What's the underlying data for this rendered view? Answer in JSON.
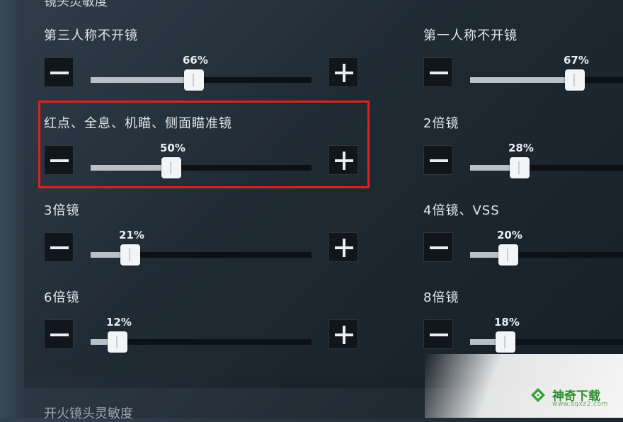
{
  "section_title": "镜头灵敏度",
  "next_section_title": "开火镜头灵敏度",
  "sliders": [
    {
      "label": "第三人称不开镜",
      "value": "66%",
      "fraction": 0.66,
      "plus": true
    },
    {
      "label": "第一人称不开镜",
      "value": "67%",
      "fraction": 0.67,
      "plus": false
    },
    {
      "label": "红点、全息、机瞄、侧面瞄准镜",
      "value": "50%",
      "fraction": 0.5,
      "plus": true
    },
    {
      "label": "2倍镜",
      "value": "28%",
      "fraction": 0.28,
      "plus": false
    },
    {
      "label": "3倍镜",
      "value": "21%",
      "fraction": 0.21,
      "plus": true
    },
    {
      "label": "4倍镜、VSS",
      "value": "20%",
      "fraction": 0.2,
      "plus": false
    },
    {
      "label": "6倍镜",
      "value": "12%",
      "fraction": 0.12,
      "plus": true
    },
    {
      "label": "8倍镜",
      "value": "18%",
      "fraction": 0.18,
      "plus": false
    }
  ],
  "highlight_color": "#e0201e",
  "watermark": {
    "text": "神奇下载",
    "sub": "www.sqxz2.com"
  }
}
